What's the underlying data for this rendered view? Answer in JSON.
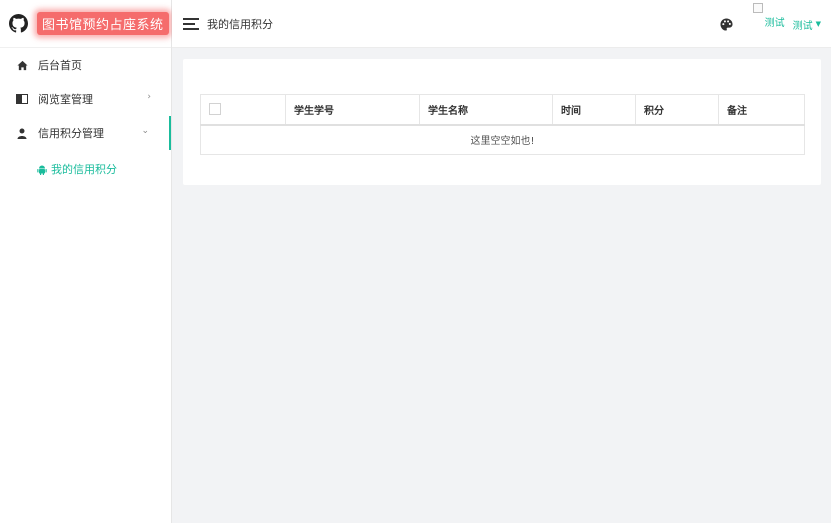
{
  "app": {
    "title": "图书馆预约占座系统",
    "accent_color": "#1abc9c",
    "brand_color": "#f56c6c"
  },
  "sidebar": {
    "items": [
      {
        "label": "后台首页",
        "icon": "home-icon"
      },
      {
        "label": "阅览室管理",
        "icon": "book-icon",
        "arrow": "›"
      },
      {
        "label": "信用积分管理",
        "icon": "user-icon",
        "arrow": "⌄"
      }
    ],
    "sub_items": [
      {
        "label": "我的信用积分",
        "icon": "android-icon"
      }
    ]
  },
  "header": {
    "page_title": "我的信用积分",
    "avatar_alt": "测试",
    "username": "测试",
    "caret": "▼"
  },
  "table": {
    "columns": [
      "学生学号",
      "学生名称",
      "时间",
      "积分",
      "备注"
    ],
    "rows": [],
    "empty_text": "这里空空如也!"
  }
}
